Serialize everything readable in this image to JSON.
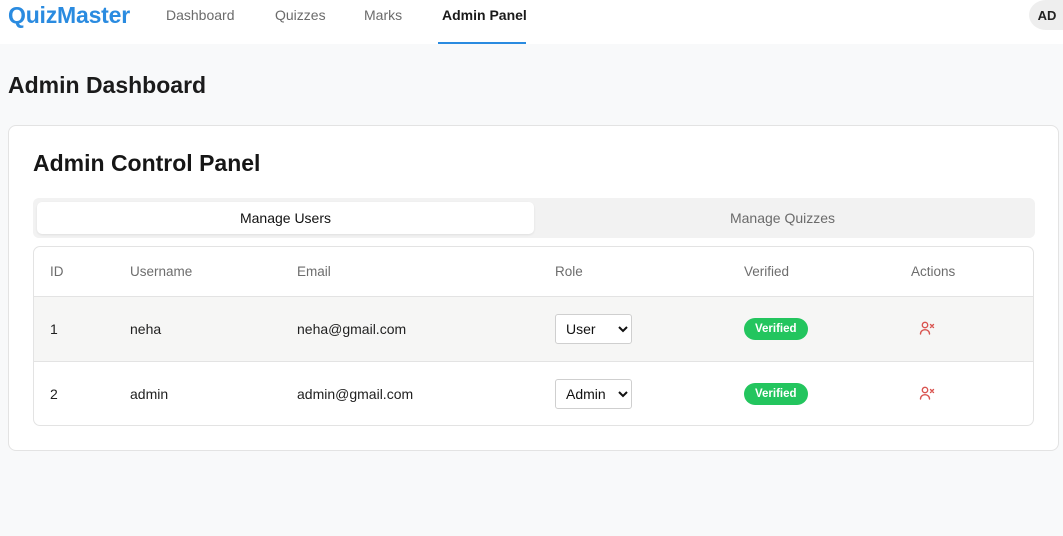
{
  "nav": {
    "brand": "QuizMaster",
    "links": [
      "Dashboard",
      "Quizzes",
      "Marks",
      "Admin Panel"
    ],
    "active": "Admin Panel",
    "avatar": "AD"
  },
  "page": {
    "title": "Admin Dashboard"
  },
  "panel": {
    "title": "Admin Control Panel",
    "tabs": [
      "Manage Users",
      "Manage Quizzes"
    ],
    "active_tab": "Manage Users"
  },
  "table": {
    "headers": [
      "ID",
      "Username",
      "Email",
      "Role",
      "Verified",
      "Actions"
    ],
    "role_options": [
      "User",
      "Admin"
    ],
    "rows": [
      {
        "id": "1",
        "username": "neha",
        "email": "neha@gmail.com",
        "role": "User",
        "verified": "Verified",
        "action_icon": "remove-user-icon"
      },
      {
        "id": "2",
        "username": "admin",
        "email": "admin@gmail.com",
        "role": "Admin",
        "verified": "Verified",
        "action_icon": "remove-user-icon"
      }
    ]
  },
  "colors": {
    "brand": "#2a8be0",
    "verified_badge": "#23c55e",
    "danger_icon": "#d9534f"
  }
}
